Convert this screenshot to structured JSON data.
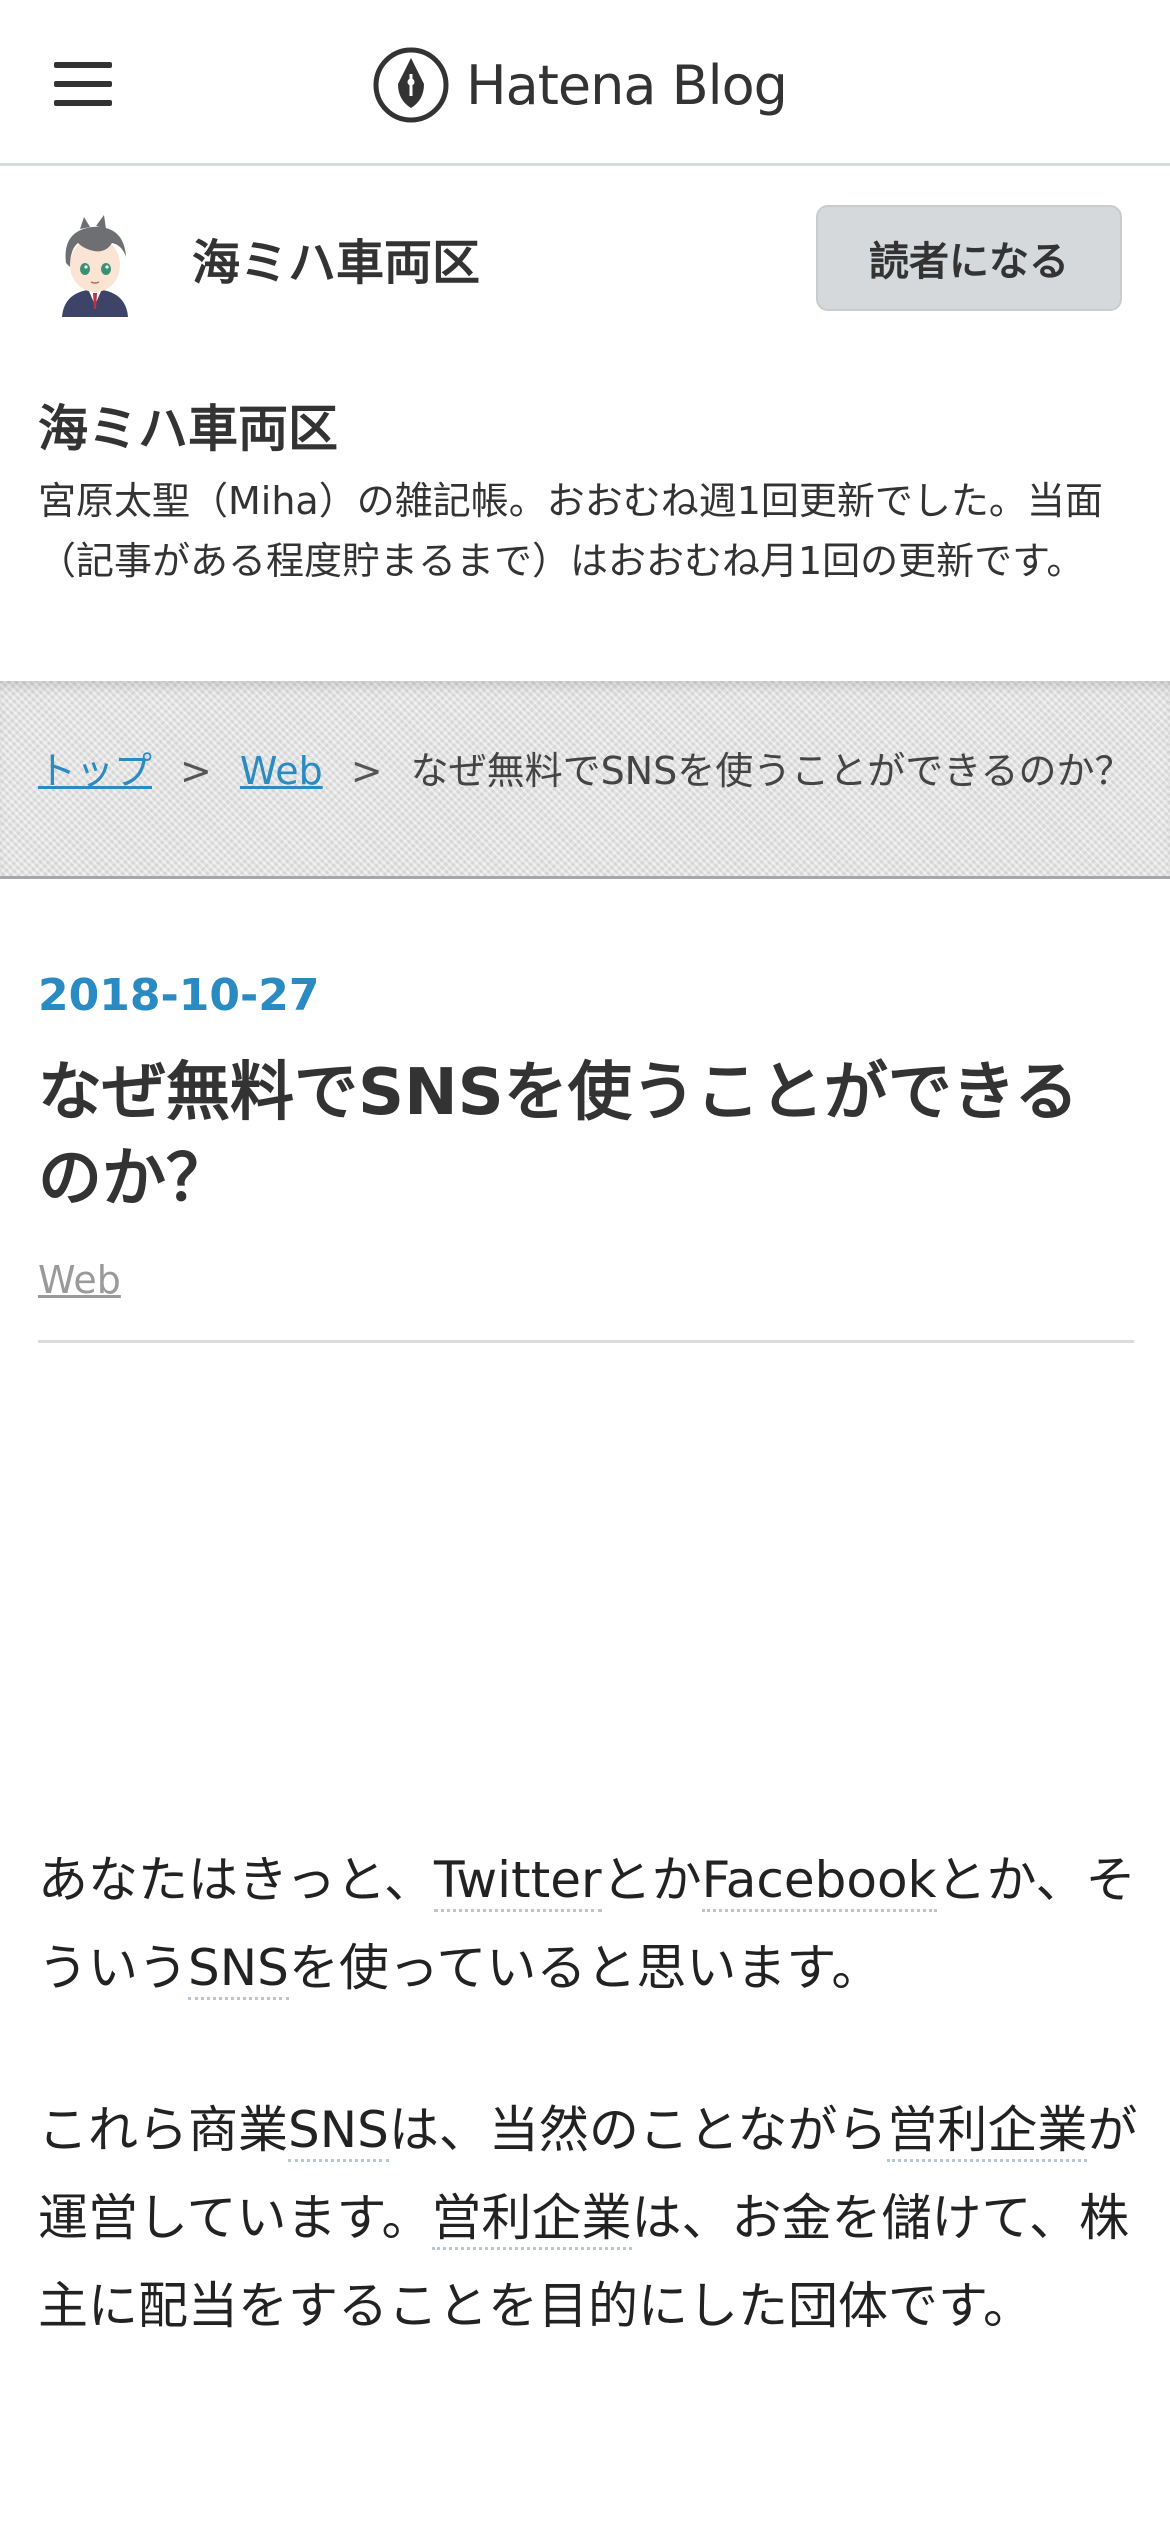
{
  "topbar": {
    "menu_icon": "hamburger-menu-icon",
    "logo_icon": "hatena-pen-logo-icon",
    "logo_text": "Hatena Blog"
  },
  "blog_header": {
    "name": "海ミハ車両区",
    "subscribe_label": "読者になる",
    "title": "海ミハ車両区",
    "description": "宮原太聖（Miha）の雑記帳。おおむね週1回更新でした。当面（記事がある程度貯まるまで）はおおむね月1回の更新です。"
  },
  "breadcrumb": {
    "top": "トップ",
    "separator": ">",
    "category": "Web",
    "current": "なぜ無料でSNSを使うことができるのか？"
  },
  "article": {
    "date": "2018-10-27",
    "title": "なぜ無料でSNSを使うことができるのか？",
    "category": "Web",
    "paragraphs": [
      {
        "t1": "あなたはきっと、",
        "k1": "Twitter",
        "t2": "とか",
        "k2": "Facebook",
        "t3": "とか、そういう",
        "k3": "SNS",
        "t4": "を使っていると思います。"
      },
      {
        "t1": "これら商業",
        "k1": "SNS",
        "t2": "は、当然のことながら",
        "k2": "営利企業",
        "t3": "が運営しています。",
        "k3": "営利企業",
        "t4": "は、お金を儲けて、株主に配当をすることを目的にした団体です。"
      }
    ]
  },
  "colors": {
    "accent_link": "#2a8ac2",
    "subscribe_bg": "#d6d9dc",
    "breadcrumb_bg": "#e6e6e6",
    "text": "#333333"
  }
}
